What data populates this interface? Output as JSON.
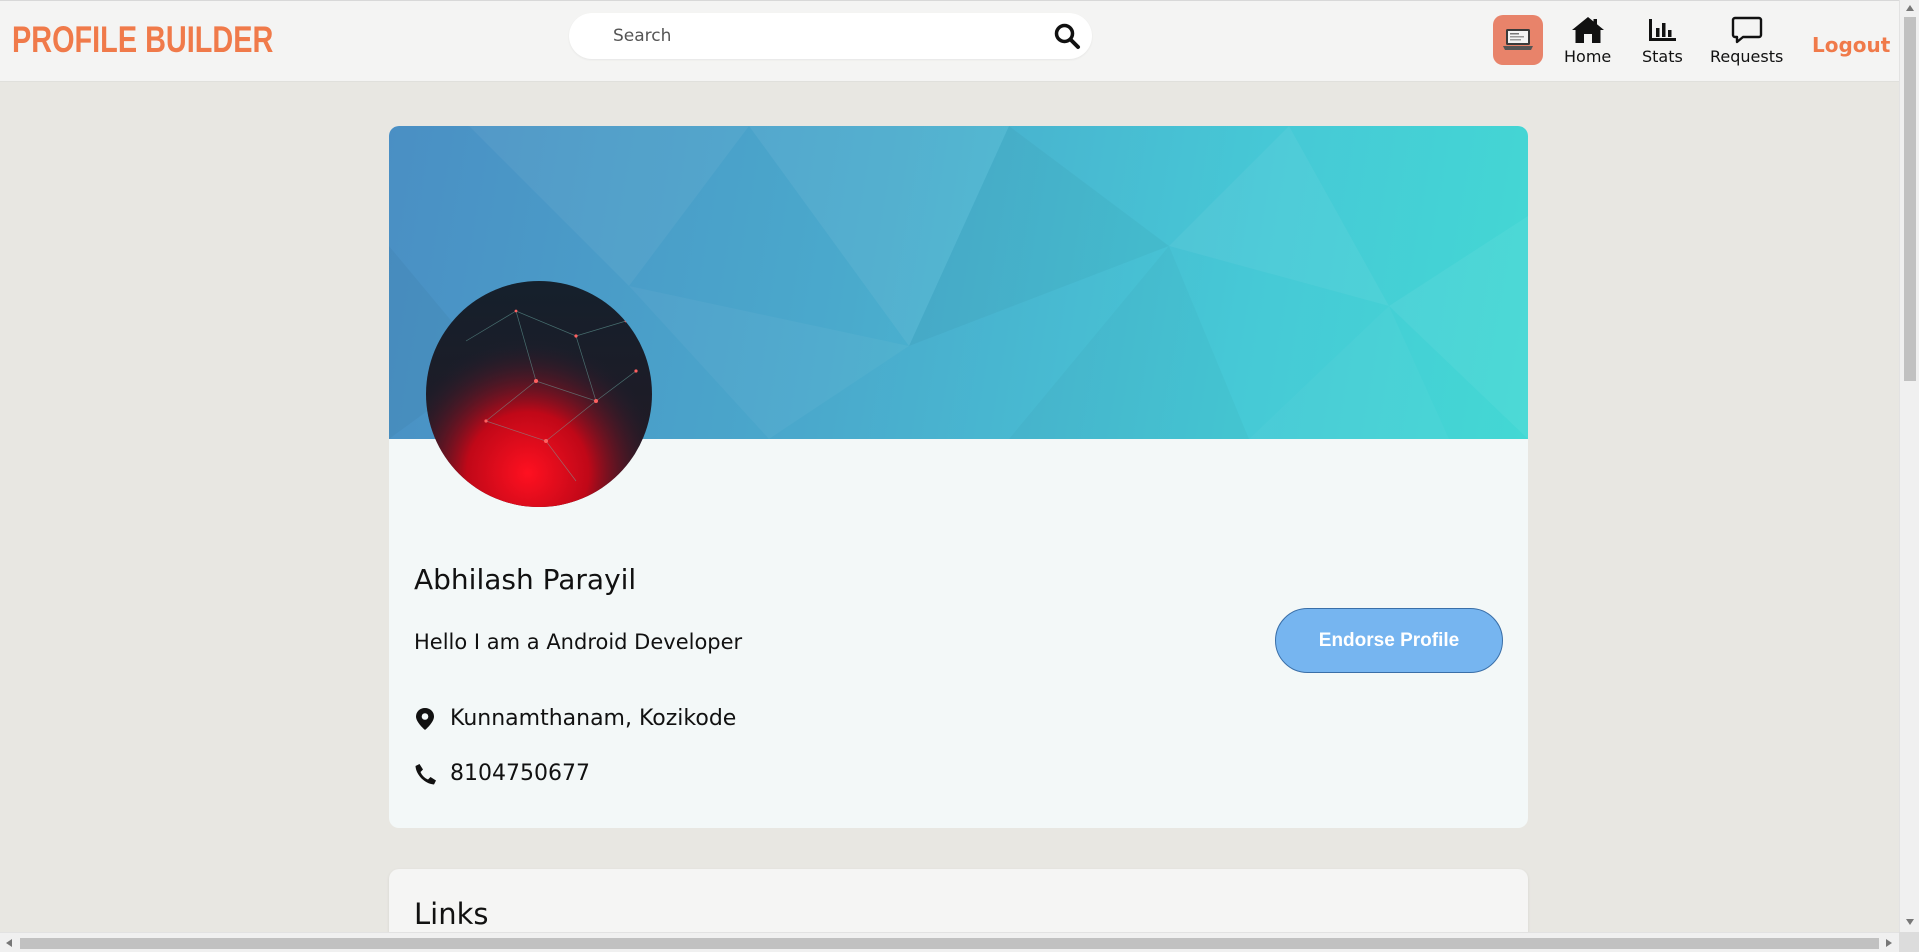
{
  "header": {
    "brand": "PROFILE BUILDER",
    "search": {
      "placeholder": "Search",
      "value": ""
    },
    "nav": [
      {
        "label": "Home",
        "icon": "home-icon"
      },
      {
        "label": "Stats",
        "icon": "stats-icon"
      },
      {
        "label": "Requests",
        "icon": "requests-icon"
      }
    ],
    "logout_label": "Logout",
    "accent_color": "#f07a4a"
  },
  "profile": {
    "name": "Abhilash Parayil",
    "bio": "Hello I am a Android Developer",
    "location": "Kunnamthanam, Kozikode",
    "phone": "8104750677",
    "endorse_label": "Endorse Profile"
  },
  "links": {
    "title": "Links"
  }
}
